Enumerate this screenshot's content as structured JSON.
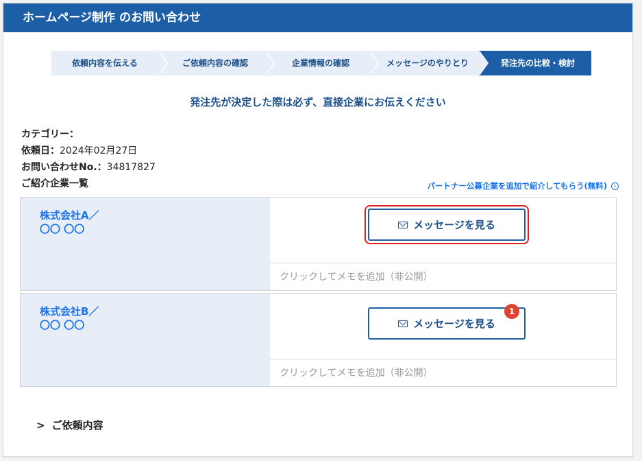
{
  "header": {
    "title": "ホームページ制作 のお問い合わせ"
  },
  "steps": [
    "依頼内容を伝える",
    "ご依頼内容の確認",
    "企業情報の確認",
    "メッセージのやりとり",
    "発注先の比較・検討"
  ],
  "notice": "発注先が決定した際は必ず、直接企業にお伝えください",
  "meta": {
    "category_label": "カテゴリー：",
    "date_label": "依頼日：",
    "date_value": "2024年02月27日",
    "inquiry_label": "お問い合わせNo.：",
    "inquiry_value": "34817827",
    "list_heading": "ご紹介企業一覧"
  },
  "partner_link": {
    "label": "パートナー公募企業を追加で紹介してもらう(無料)",
    "icon": "chevron-right-circle-icon"
  },
  "companies": [
    {
      "name": "株式会社A／",
      "person": "〇〇 〇〇",
      "button_label": "メッセージを見る",
      "memo_placeholder": "クリックしてメモを追加（非公開）",
      "unread": ""
    },
    {
      "name": "株式会社B／",
      "person": "〇〇 〇〇",
      "button_label": "メッセージを見る",
      "memo_placeholder": "クリックしてメモを追加（非公開）",
      "unread": "1"
    }
  ],
  "details_toggle": {
    "label": "ご依頼内容"
  },
  "colors": {
    "brand": "#1d5fa6",
    "link": "#1a73e8",
    "highlight": "#e02020",
    "badge": "#e0422f"
  }
}
